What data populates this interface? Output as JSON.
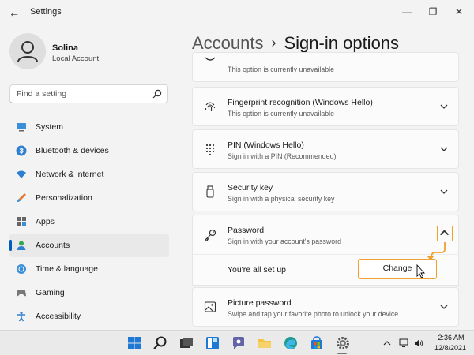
{
  "window": {
    "title": "Settings"
  },
  "profile": {
    "name": "Solina",
    "account_type": "Local Account"
  },
  "search": {
    "placeholder": "Find a setting"
  },
  "sidebar": {
    "items": [
      {
        "label": "System",
        "icon": "monitor-icon",
        "active": false
      },
      {
        "label": "Bluetooth & devices",
        "icon": "bluetooth-icon",
        "active": false
      },
      {
        "label": "Network & internet",
        "icon": "wifi-icon",
        "active": false
      },
      {
        "label": "Personalization",
        "icon": "brush-icon",
        "active": false
      },
      {
        "label": "Apps",
        "icon": "apps-icon",
        "active": false
      },
      {
        "label": "Accounts",
        "icon": "person-icon",
        "active": true
      },
      {
        "label": "Time & language",
        "icon": "globe-icon",
        "active": false
      },
      {
        "label": "Gaming",
        "icon": "gamepad-icon",
        "active": false
      },
      {
        "label": "Accessibility",
        "icon": "accessibility-icon",
        "active": false
      }
    ]
  },
  "breadcrumb": {
    "parent": "Accounts",
    "separator": "›",
    "current": "Sign-in options"
  },
  "options": [
    {
      "title": "",
      "desc": "This option is currently unavailable",
      "icon": "face-icon"
    },
    {
      "title": "Fingerprint recognition (Windows Hello)",
      "desc": "This option is currently unavailable",
      "icon": "fingerprint-icon"
    },
    {
      "title": "PIN (Windows Hello)",
      "desc": "Sign in with a PIN (Recommended)",
      "icon": "pin-keypad-icon"
    },
    {
      "title": "Security key",
      "desc": "Sign in with a physical security key",
      "icon": "usb-key-icon"
    },
    {
      "title": "Password",
      "desc": "Sign in with your account's password",
      "icon": "key-icon",
      "expanded": true
    },
    {
      "title": "Picture password",
      "desc": "Swipe and tap your favorite photo to unlock your device",
      "icon": "image-icon"
    }
  ],
  "password_panel": {
    "status": "You're all set up",
    "button_label": "Change"
  },
  "taskbar": {
    "apps": [
      "start-icon",
      "search-icon",
      "terminal-icon",
      "widgets-icon",
      "teams-chat-icon",
      "file-explorer-icon",
      "edge-icon",
      "store-icon",
      "settings-icon"
    ],
    "active_app": "settings-icon"
  },
  "tray": {
    "time": "2:36 AM",
    "date": "12/8/2021"
  },
  "colors": {
    "accent": "#005fb8",
    "highlight": "#f0a030"
  }
}
